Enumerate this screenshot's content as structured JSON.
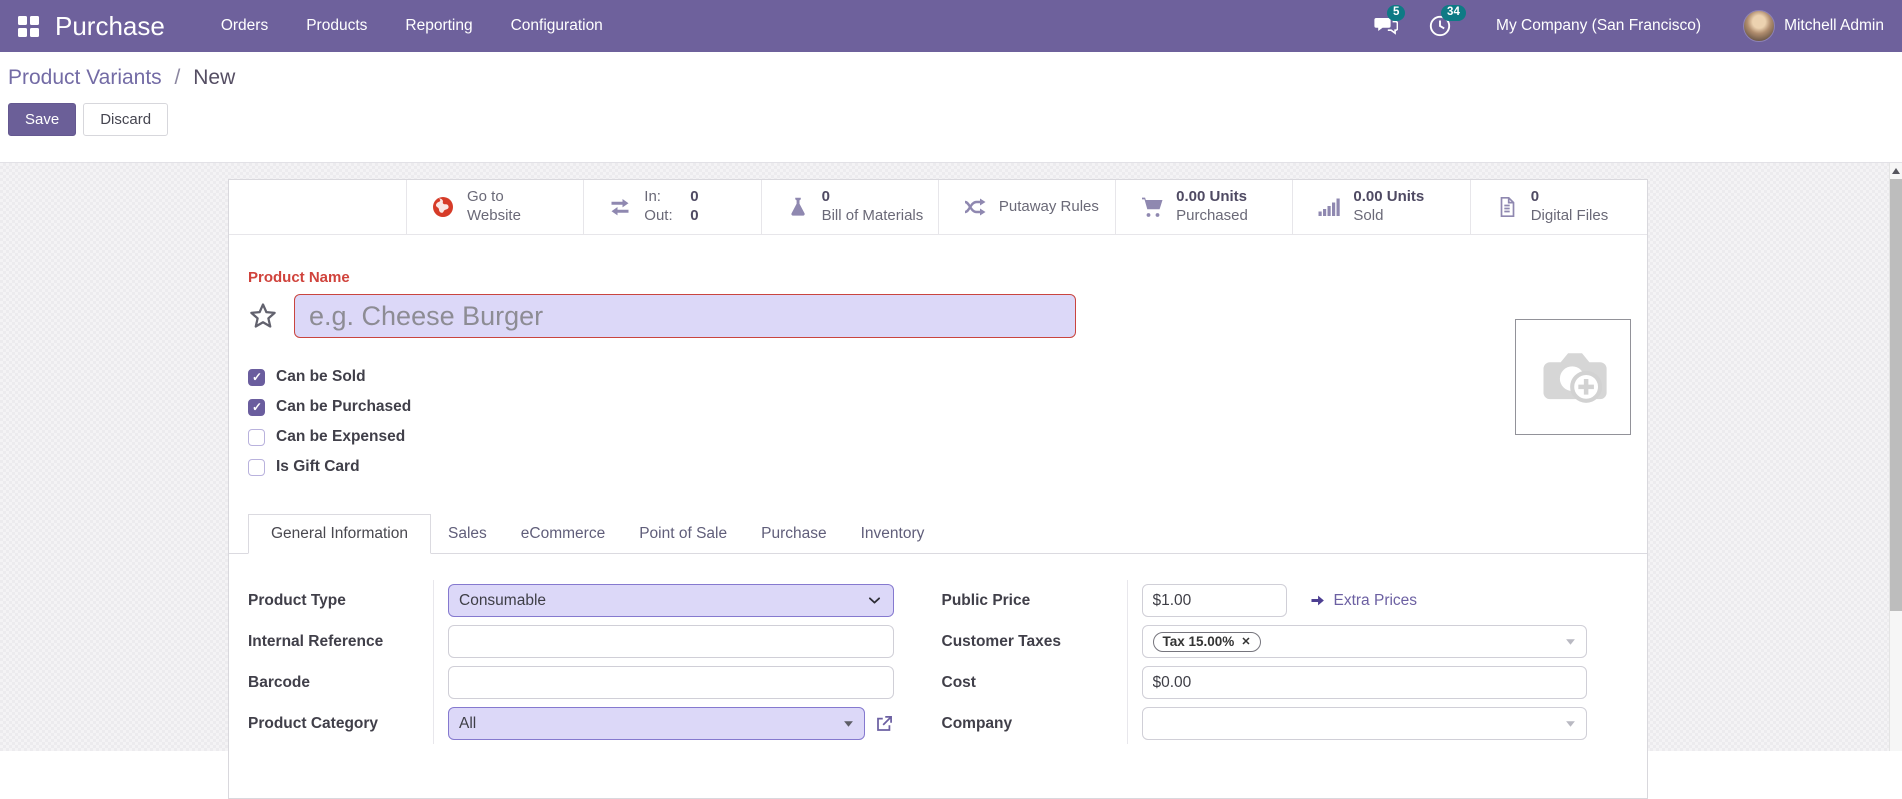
{
  "colors": {
    "navbar_bg": "#6e619c",
    "badge_bg": "#0e7a85",
    "primary_button_bg": "#6b5f98",
    "link_purple": "#6c60a2",
    "required_red": "#d0433c",
    "field_highlight_bg": "#dcd8f8",
    "field_highlight_border": "#8579cf",
    "checkbox_checked_bg": "#6a5d9e",
    "website_globe_red": "#d63b28"
  },
  "navbar": {
    "app_name": "Purchase",
    "menus": [
      {
        "label": "Orders"
      },
      {
        "label": "Products"
      },
      {
        "label": "Reporting"
      },
      {
        "label": "Configuration"
      }
    ],
    "messages": {
      "icon": "chat-bubbles-icon",
      "badge": "5"
    },
    "activities": {
      "icon": "clock-icon",
      "badge": "34"
    },
    "company": "My Company (San Francisco)",
    "user": {
      "name": "Mitchell Admin"
    }
  },
  "control_panel": {
    "breadcrumb": {
      "parent": "Product Variants",
      "separator": "/",
      "current": "New"
    },
    "buttons": {
      "save": "Save",
      "discard": "Discard"
    }
  },
  "stat_buttons": [
    {
      "icon": "globe-icon",
      "line1": "Go to",
      "line2": "Website"
    },
    {
      "icon": "transfer-arrows-icon",
      "in_label": "In:",
      "in_value": "0",
      "out_label": "Out:",
      "out_value": "0"
    },
    {
      "icon": "flask-icon",
      "value": "0",
      "label": "Bill of Materials"
    },
    {
      "icon": "shuffle-icon",
      "label": "Putaway Rules"
    },
    {
      "icon": "cart-icon",
      "value": "0.00 Units",
      "label": "Purchased"
    },
    {
      "icon": "bar-chart-icon",
      "value": "0.00 Units",
      "label": "Sold"
    },
    {
      "icon": "document-icon",
      "value": "0",
      "label": "Digital Files"
    }
  ],
  "product": {
    "name_label": "Product Name",
    "name_placeholder": "e.g. Cheese Burger",
    "checkboxes": [
      {
        "label": "Can be Sold",
        "checked": true
      },
      {
        "label": "Can be Purchased",
        "checked": true
      },
      {
        "label": "Can be Expensed",
        "checked": false
      },
      {
        "label": "Is Gift Card",
        "checked": false
      }
    ]
  },
  "tabs": [
    {
      "label": "General Information",
      "active": true
    },
    {
      "label": "Sales",
      "active": false
    },
    {
      "label": "eCommerce",
      "active": false
    },
    {
      "label": "Point of Sale",
      "active": false
    },
    {
      "label": "Purchase",
      "active": false
    },
    {
      "label": "Inventory",
      "active": false
    }
  ],
  "form": {
    "product_type": {
      "label": "Product Type",
      "value": "Consumable"
    },
    "internal_reference": {
      "label": "Internal Reference",
      "value": ""
    },
    "barcode": {
      "label": "Barcode",
      "value": ""
    },
    "product_category": {
      "label": "Product Category",
      "value": "All"
    },
    "public_price": {
      "label": "Public Price",
      "value": "$1.00",
      "link": "Extra Prices"
    },
    "customer_taxes": {
      "label": "Customer Taxes",
      "tags": [
        {
          "label": "Tax 15.00%"
        }
      ]
    },
    "cost": {
      "label": "Cost",
      "value": "$0.00"
    },
    "company": {
      "label": "Company",
      "value": ""
    }
  }
}
